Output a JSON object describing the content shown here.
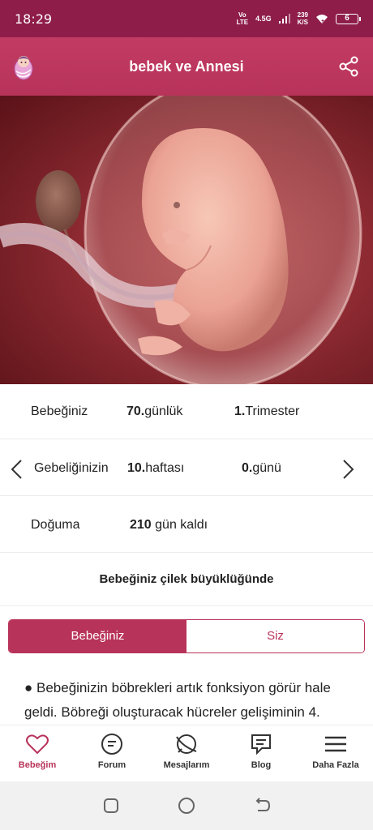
{
  "status_bar": {
    "time": "18:29",
    "volte_top": "Vo",
    "volte_bottom": "LTE",
    "network": "4.5G",
    "speed_value": "239",
    "speed_unit": "K/S",
    "battery": "6"
  },
  "app_bar": {
    "title": "bebek ve Annesi",
    "logo_icon": "baby-icon",
    "share_icon": "share-icon"
  },
  "colors": {
    "status_bar": "#8e1d4a",
    "accent": "#b8335a"
  },
  "info": {
    "row1": {
      "label": "Bebeğiniz",
      "value_bold": "70.",
      "value_rest": "günlük",
      "extra_bold": "1.",
      "extra_rest": "Trimester"
    },
    "row2": {
      "label": "Gebeliğinizin",
      "value_bold": "10.",
      "value_rest": "haftası",
      "extra_bold": "0.",
      "extra_rest": "günü"
    },
    "row3": {
      "label": "Doğuma",
      "value_bold": "210",
      "value_rest": " gün kaldı"
    }
  },
  "size_text": "Bebeğiniz çilek büyüklüğünde",
  "tabs": [
    {
      "label": "Bebeğiniz",
      "active": true
    },
    {
      "label": "Siz",
      "active": false
    }
  ],
  "content": {
    "text": "● Bebeğinizin böbrekleri artık fonksiyon görür hale geldi. Böbreği oluşturacak hücreler gelişiminin 4."
  },
  "bottom_nav": [
    {
      "label": "Bebeğim",
      "icon": "heart-icon",
      "active": true
    },
    {
      "label": "Forum",
      "icon": "forum-icon",
      "active": false
    },
    {
      "label": "Mesajlarım",
      "icon": "messages-icon",
      "active": false
    },
    {
      "label": "Blog",
      "icon": "blog-icon",
      "active": false
    },
    {
      "label": "Daha Fazla",
      "icon": "menu-icon",
      "active": false
    }
  ]
}
